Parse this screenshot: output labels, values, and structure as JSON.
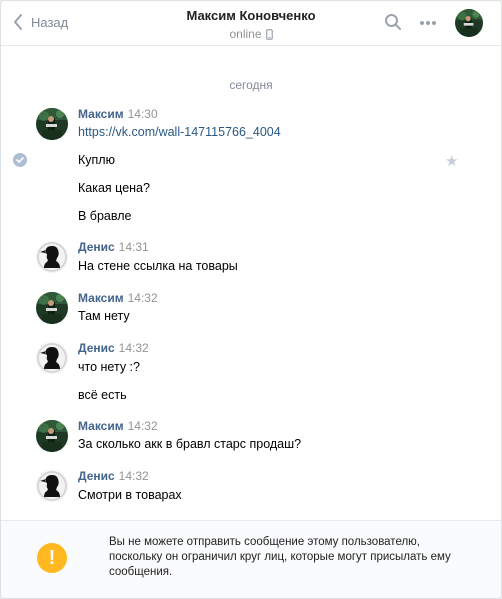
{
  "header": {
    "back_label": "Назад",
    "title": "Максим Коновченко",
    "status": "online"
  },
  "date_separator": "сегодня",
  "messages": [
    {
      "author": "Максим",
      "time": "14:30",
      "avatar": "maksim",
      "lines": [
        "https://vk.com/wall-147115766_4004",
        "Куплю",
        "Какая цена?",
        "В бравле"
      ]
    },
    {
      "author": "Денис",
      "time": "14:31",
      "avatar": "denis",
      "lines": [
        "На стене ссылка на товары"
      ]
    },
    {
      "author": "Максим",
      "time": "14:32",
      "avatar": "maksim",
      "lines": [
        "Там нету"
      ]
    },
    {
      "author": "Денис",
      "time": "14:32",
      "avatar": "denis",
      "lines": [
        "что нету :?",
        "всё есть"
      ]
    },
    {
      "author": "Максим",
      "time": "14:32",
      "avatar": "maksim",
      "lines": [
        "За сколько акк в бравл старс продаш?"
      ]
    },
    {
      "author": "Денис",
      "time": "14:32",
      "avatar": "denis",
      "lines": [
        "Смотри в товарах"
      ]
    }
  ],
  "notice": {
    "icon": "!",
    "text": "Вы не можете отправить сообщение этому пользователю, поскольку он ограничил круг лиц, которые могут присылать ему сообщения."
  },
  "colors": {
    "accent": "#42648b",
    "link": "#2a5885",
    "muted": "#939393",
    "warning": "#ffb820"
  }
}
